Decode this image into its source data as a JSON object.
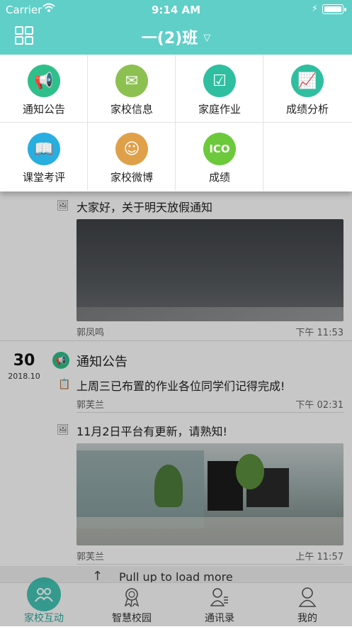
{
  "status_bar": {
    "carrier": "Carrier",
    "time": "9:14 AM"
  },
  "header": {
    "title": "一(2)班"
  },
  "menu": [
    {
      "label": "通知公告",
      "icon": "megaphone-icon",
      "color": "#2fbf8a"
    },
    {
      "label": "家校信息",
      "icon": "mail-icon",
      "color": "#8cc152"
    },
    {
      "label": "家庭作业",
      "icon": "homework-icon",
      "color": "#2fbfa0"
    },
    {
      "label": "成绩分析",
      "icon": "chart-icon",
      "color": "#2fbfa0"
    },
    {
      "label": "课堂考评",
      "icon": "book-icon",
      "color": "#29aee0"
    },
    {
      "label": "家校微博",
      "icon": "weibo-icon",
      "color": "#e0a04a"
    },
    {
      "label": "成绩",
      "icon": "score-icon",
      "color": "#6bc93b"
    }
  ],
  "feed": {
    "post1": {
      "text": "大家好，关于明天放假通知",
      "author": "郭凤鸣",
      "time": "下午 11:53"
    },
    "day_group": {
      "day": "30",
      "date": "2018.10",
      "category": "通知公告"
    },
    "post2": {
      "text": "上周三已布置的作业各位同学们记得完成!",
      "author": "郭芙兰",
      "time": "下午 02:31"
    },
    "post3": {
      "text": "11月2日平台有更新，请熟知!",
      "author": "郭芙兰",
      "time": "上午 11:57"
    },
    "pull_text": "Pull up to load more"
  },
  "tabs": [
    {
      "label": "家校互动",
      "icon": "people-icon",
      "active": true
    },
    {
      "label": "智慧校园",
      "icon": "award-icon",
      "active": false
    },
    {
      "label": "通讯录",
      "icon": "contacts-icon",
      "active": false
    },
    {
      "label": "我的",
      "icon": "user-icon",
      "active": false
    }
  ]
}
